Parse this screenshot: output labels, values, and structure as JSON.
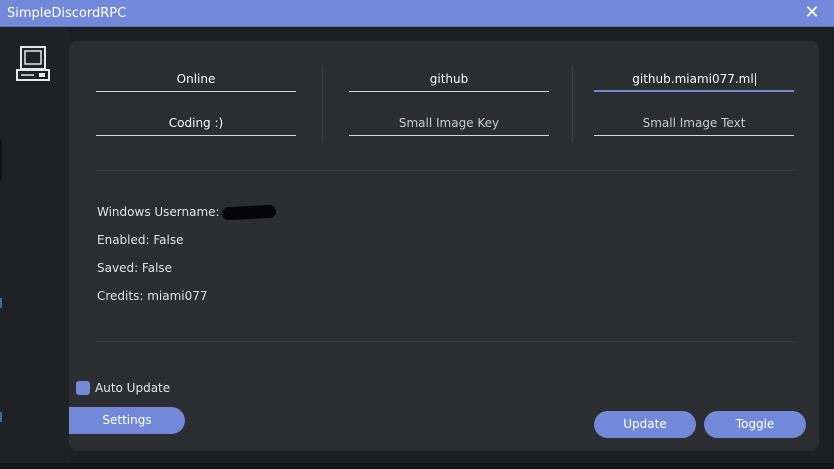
{
  "window": {
    "title": "SimpleDiscordRPC",
    "close_icon": "close-icon"
  },
  "fields": {
    "details": {
      "value": "Online"
    },
    "large_image_key": {
      "value": "github"
    },
    "large_image_text": {
      "value": "github.miami077.ml"
    },
    "state": {
      "value": "Coding :)"
    },
    "small_image_key": {
      "placeholder": "Small Image Key"
    },
    "small_image_text": {
      "placeholder": "Small Image Text"
    }
  },
  "info": {
    "windows_username_label": "Windows Username:",
    "enabled": "Enabled: False",
    "saved": "Saved: False",
    "credits": "Credits: miami077"
  },
  "options": {
    "auto_update_label": "Auto Update",
    "auto_update_checked": true
  },
  "buttons": {
    "settings": "Settings",
    "update": "Update",
    "toggle": "Toggle"
  },
  "colors": {
    "accent": "#7289da",
    "panel": "#2b2d31",
    "background": "#1e1f22"
  }
}
